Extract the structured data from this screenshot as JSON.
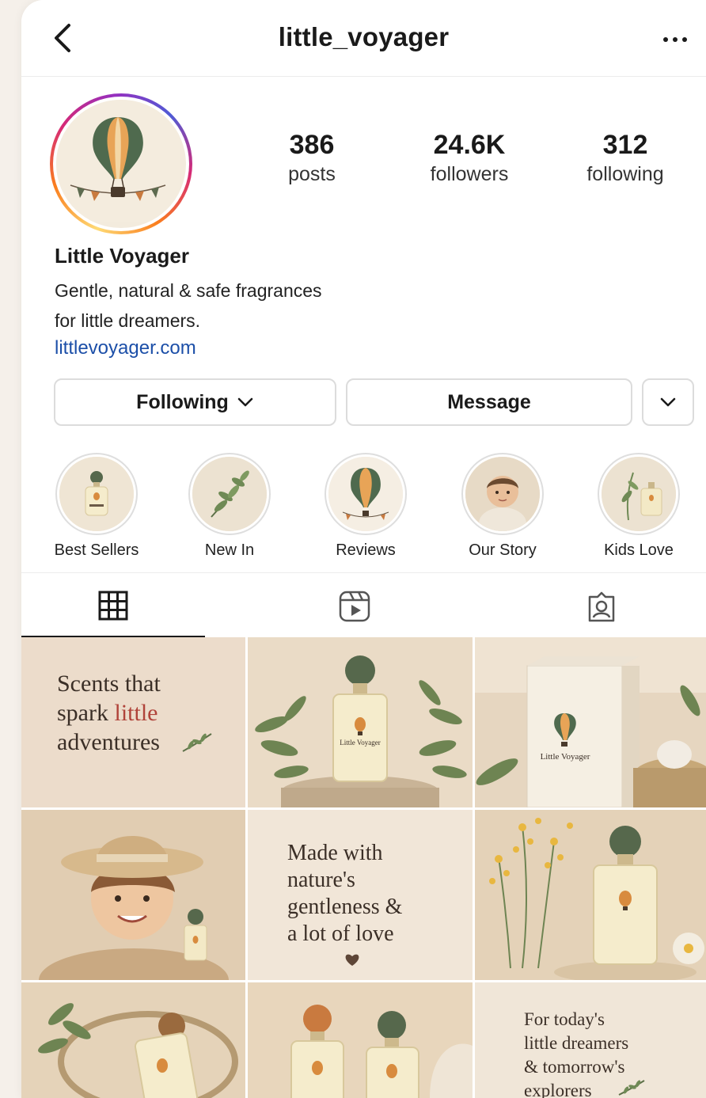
{
  "header": {
    "username": "little_voyager"
  },
  "stats": [
    {
      "value": "386",
      "label": "posts"
    },
    {
      "value": "24.6K",
      "label": "followers"
    },
    {
      "value": "312",
      "label": "following"
    }
  ],
  "profile": {
    "name": "Little Voyager",
    "bio_line1": "Gentle, natural & safe fragrances",
    "bio_line2": "for little dreamers.",
    "link": "littlevoyager.com"
  },
  "actions": {
    "following_label": "Following",
    "message_label": "Message"
  },
  "highlights": [
    {
      "label": "Best Sellers"
    },
    {
      "label": "New In"
    },
    {
      "label": "Reviews"
    },
    {
      "label": "Our Story"
    },
    {
      "label": "Kids Love"
    }
  ],
  "tabs": [
    {
      "icon": "grid-icon"
    },
    {
      "icon": "reels-icon"
    },
    {
      "icon": "tagged-icon"
    }
  ],
  "posts": {
    "quote1_l1": "Scents that",
    "quote1_l2a": "spark ",
    "quote1_l2b": "little",
    "quote1_l3": "adventures",
    "bottle_label": "Little Voyager",
    "quote2_l1": "Made with",
    "quote2_l2": "nature's",
    "quote2_l3": "gentleness &",
    "quote2_l4": "a lot of love",
    "quote3_l1": "For today's",
    "quote3_l2": "little dreamers",
    "quote3_l3": "& tomorrow's",
    "quote3_l4": "explorers"
  },
  "colors": {
    "link": "#1c4fa8",
    "accent_red": "#b0433a",
    "bottle_green": "#5d6b4f",
    "bottle_orange": "#c97a3f"
  }
}
